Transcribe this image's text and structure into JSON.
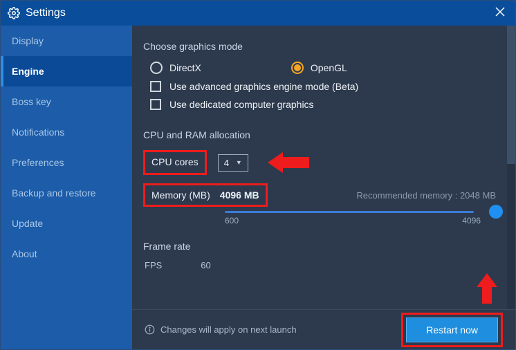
{
  "header": {
    "title": "Settings"
  },
  "sidebar": {
    "items": [
      {
        "label": "Display"
      },
      {
        "label": "Engine"
      },
      {
        "label": "Boss key"
      },
      {
        "label": "Notifications"
      },
      {
        "label": "Preferences"
      },
      {
        "label": "Backup and restore"
      },
      {
        "label": "Update"
      },
      {
        "label": "About"
      }
    ],
    "active_index": 1
  },
  "graphics_mode": {
    "title": "Choose graphics mode",
    "options": [
      {
        "label": "DirectX",
        "selected": false
      },
      {
        "label": "OpenGL",
        "selected": true
      }
    ],
    "advanced_checkbox": "Use advanced graphics engine mode (Beta)",
    "dedicated_checkbox": "Use dedicated computer graphics"
  },
  "allocation": {
    "title": "CPU and RAM allocation",
    "cpu_label": "CPU cores",
    "cpu_value": "4",
    "memory_label": "Memory (MB)",
    "memory_value": "4096 MB",
    "recommended_label": "Recommended memory : 2048 MB",
    "slider_min": "600",
    "slider_max": "4096"
  },
  "frame_rate": {
    "title": "Frame rate",
    "fps_label": "FPS",
    "fps_value": "60"
  },
  "footer": {
    "message": "Changes will apply on next launch",
    "restart_label": "Restart now"
  }
}
